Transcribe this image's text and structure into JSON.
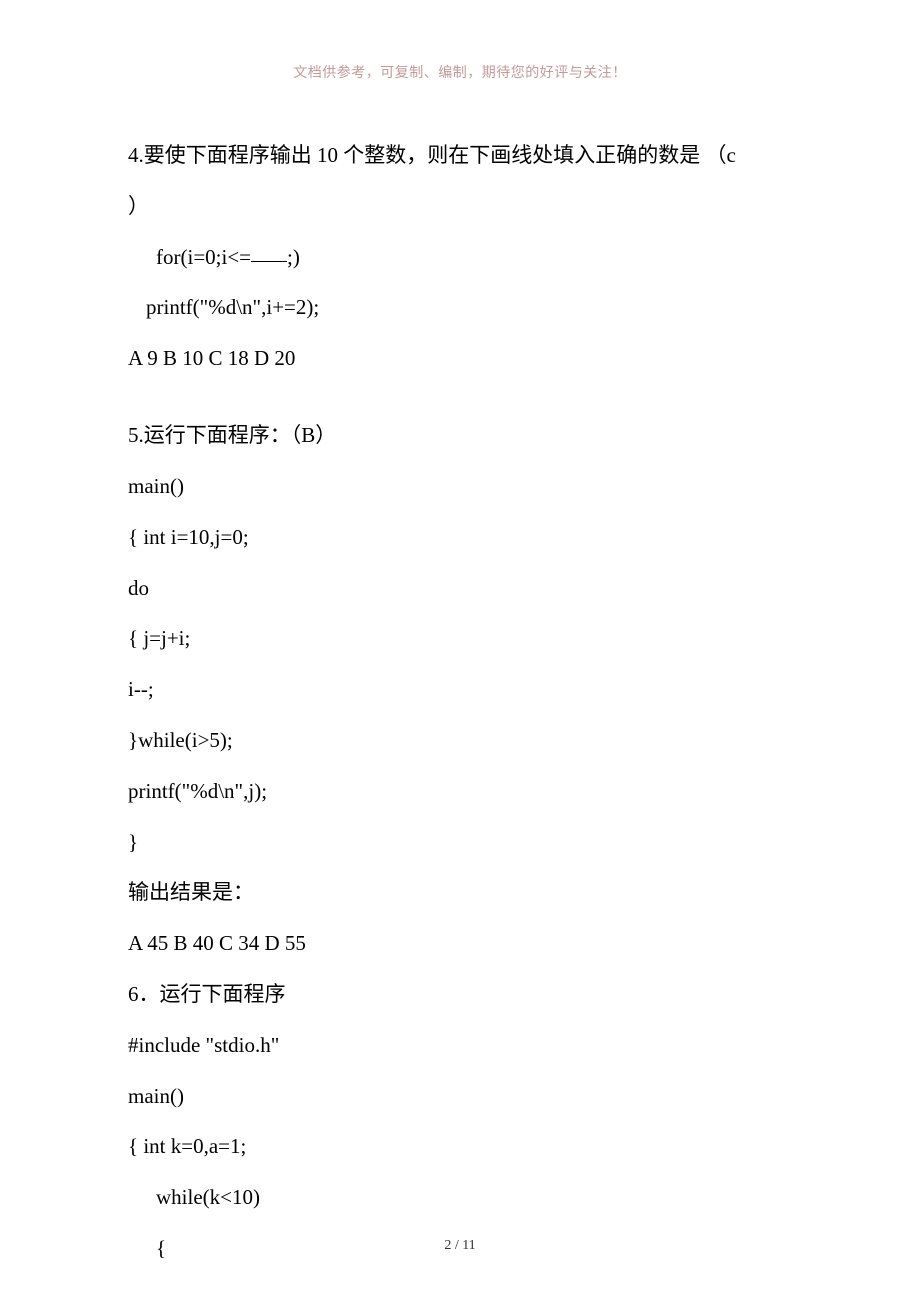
{
  "header": {
    "note": "文档供参考，可复制、编制，期待您的好评与关注！"
  },
  "q4": {
    "prompt_a": " 4.要使下面程序输出 10 个整数，则在下画线处填入正确的数是 （c",
    "prompt_b": "）",
    "code1_pre": "for(i=0;i<=",
    "code1_post": ";)",
    "code2": "printf(\"%d\\n\",i+=2);",
    "opts": "A    9      B    10       C    18    D    20"
  },
  "q5": {
    "prompt": "5.运行下面程序：（B）",
    "c1": "main()",
    "c2": "{ int i=10,j=0;",
    "c3": "do",
    "c4": "{ j=j+i;",
    "c5": "i--;",
    "c6": "}while(i>5);",
    "c7": "printf(\"%d\\n\",j);",
    "c8": "}",
    "result_label": "输出结果是：",
    "opts": "A    45       B    40       C    34       D    55"
  },
  "q6": {
    "prompt": "6．运行下面程序",
    "c1": "#include \"stdio.h\"",
    "c2": "main()",
    "c3": "{ int k=0,a=1;",
    "c4": "while(k<10)",
    "c5": "{"
  },
  "footer": {
    "page": "2 / 11"
  }
}
